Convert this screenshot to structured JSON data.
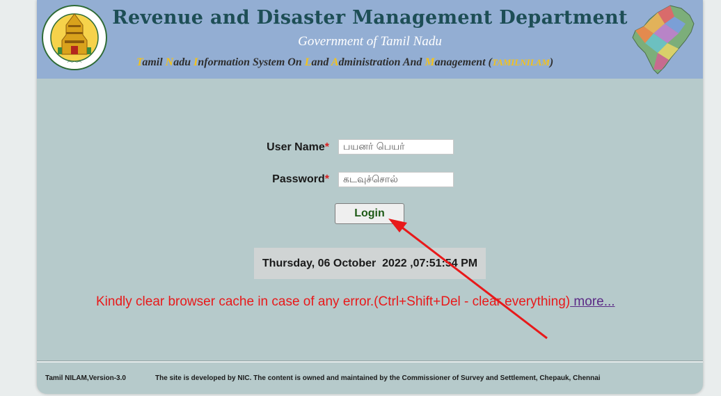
{
  "header": {
    "title": "Revenue and Disaster Management Department",
    "subtitle": "Government of Tamil Nadu",
    "system_parts": [
      {
        "text": "T",
        "ini": true
      },
      {
        "text": "amil ",
        "ini": false
      },
      {
        "text": "N",
        "ini": true
      },
      {
        "text": "adu ",
        "ini": false
      },
      {
        "text": "I",
        "ini": true
      },
      {
        "text": "nformation System On ",
        "ini": false
      },
      {
        "text": "L",
        "ini": true
      },
      {
        "text": "and ",
        "ini": false
      },
      {
        "text": "A",
        "ini": true
      },
      {
        "text": "dministration And ",
        "ini": false
      },
      {
        "text": "M",
        "ini": true
      },
      {
        "text": "anagement (",
        "ini": false
      }
    ],
    "system_acronym": "TAMILNILAM",
    "system_close": ")",
    "emblem_icon": "tamil-nadu-emblem-icon",
    "map_icon": "tamil-nadu-map-icon",
    "colors": {
      "header_bg": "#93aed3",
      "title": "#1d4e55",
      "accent": "#f3c21b",
      "page_bg": "#b6cacb"
    }
  },
  "login_form": {
    "username_label": "User Name",
    "username_placeholder": "பயனர் பெயர்",
    "password_label": "Password",
    "password_placeholder": "கடவுச்சொல்",
    "required_mark": "*",
    "login_label": "Login"
  },
  "datetime": "Thursday, 06 October  2022 ,07:51:54 PM",
  "notice": {
    "text": "Kindly clear browser cache in case of any error.(Ctrl+Shift+Del - clear everything)",
    "link": " more..."
  },
  "footer": {
    "version": "Tamil NILAM,Version-3.0",
    "credits": "The site is developed by NIC. The content is owned and maintained by the Commissioner of Survey and Settlement, Chepauk, Chennai"
  },
  "annotation": {
    "arrow_color": "#e8191a",
    "arrow_icon": "red-arrow-icon"
  }
}
